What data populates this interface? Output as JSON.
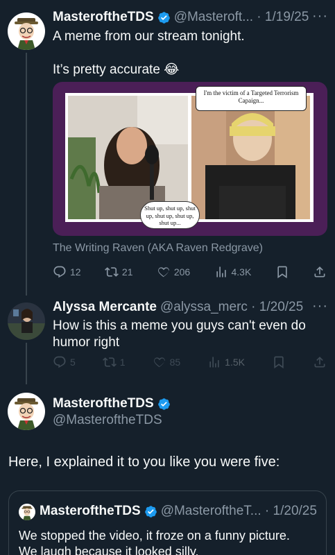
{
  "tweet1": {
    "name": "MasteroftheTDS",
    "handle": "@Masteroft...",
    "date": "1/19/25",
    "line1": "A meme from our stream tonight.",
    "line2": "It’s pretty accurate",
    "emoji": "😂",
    "media": {
      "caption_top": "I'm the victim of a Targeted Terrorism Capaign...",
      "thought": "Shut up, shut up, shut up, shut up, shut up, shut up...",
      "source": "The Writing Raven (AKA Raven Redgrave)"
    },
    "stats": {
      "replies": "12",
      "retweets": "21",
      "likes": "206",
      "views": "4.3K"
    }
  },
  "tweet2": {
    "name": "Alyssa Mercante",
    "handle": "@alyssa_merc",
    "date": "1/20/25",
    "text": "How is this a meme you guys can't even do humor right",
    "stats": {
      "replies": "5",
      "retweets": "1",
      "likes": "85",
      "views": "1.5K"
    }
  },
  "tweet3": {
    "name": "MasteroftheTDS",
    "handle": "@MasteroftheTDS",
    "text": "Here, I explained it to you like you were five:",
    "quote": {
      "name": "MasteroftheTDS",
      "handle": "@MasteroftheT...",
      "date": "1/20/25",
      "line1": "We stopped the video, it froze on a funny picture.",
      "line2": "We laugh because it looked silly."
    }
  },
  "colors": {
    "background": "#15202b",
    "muted": "#8b98a5",
    "verified": "#1d9bf0",
    "media_border": "#4b1f57"
  }
}
